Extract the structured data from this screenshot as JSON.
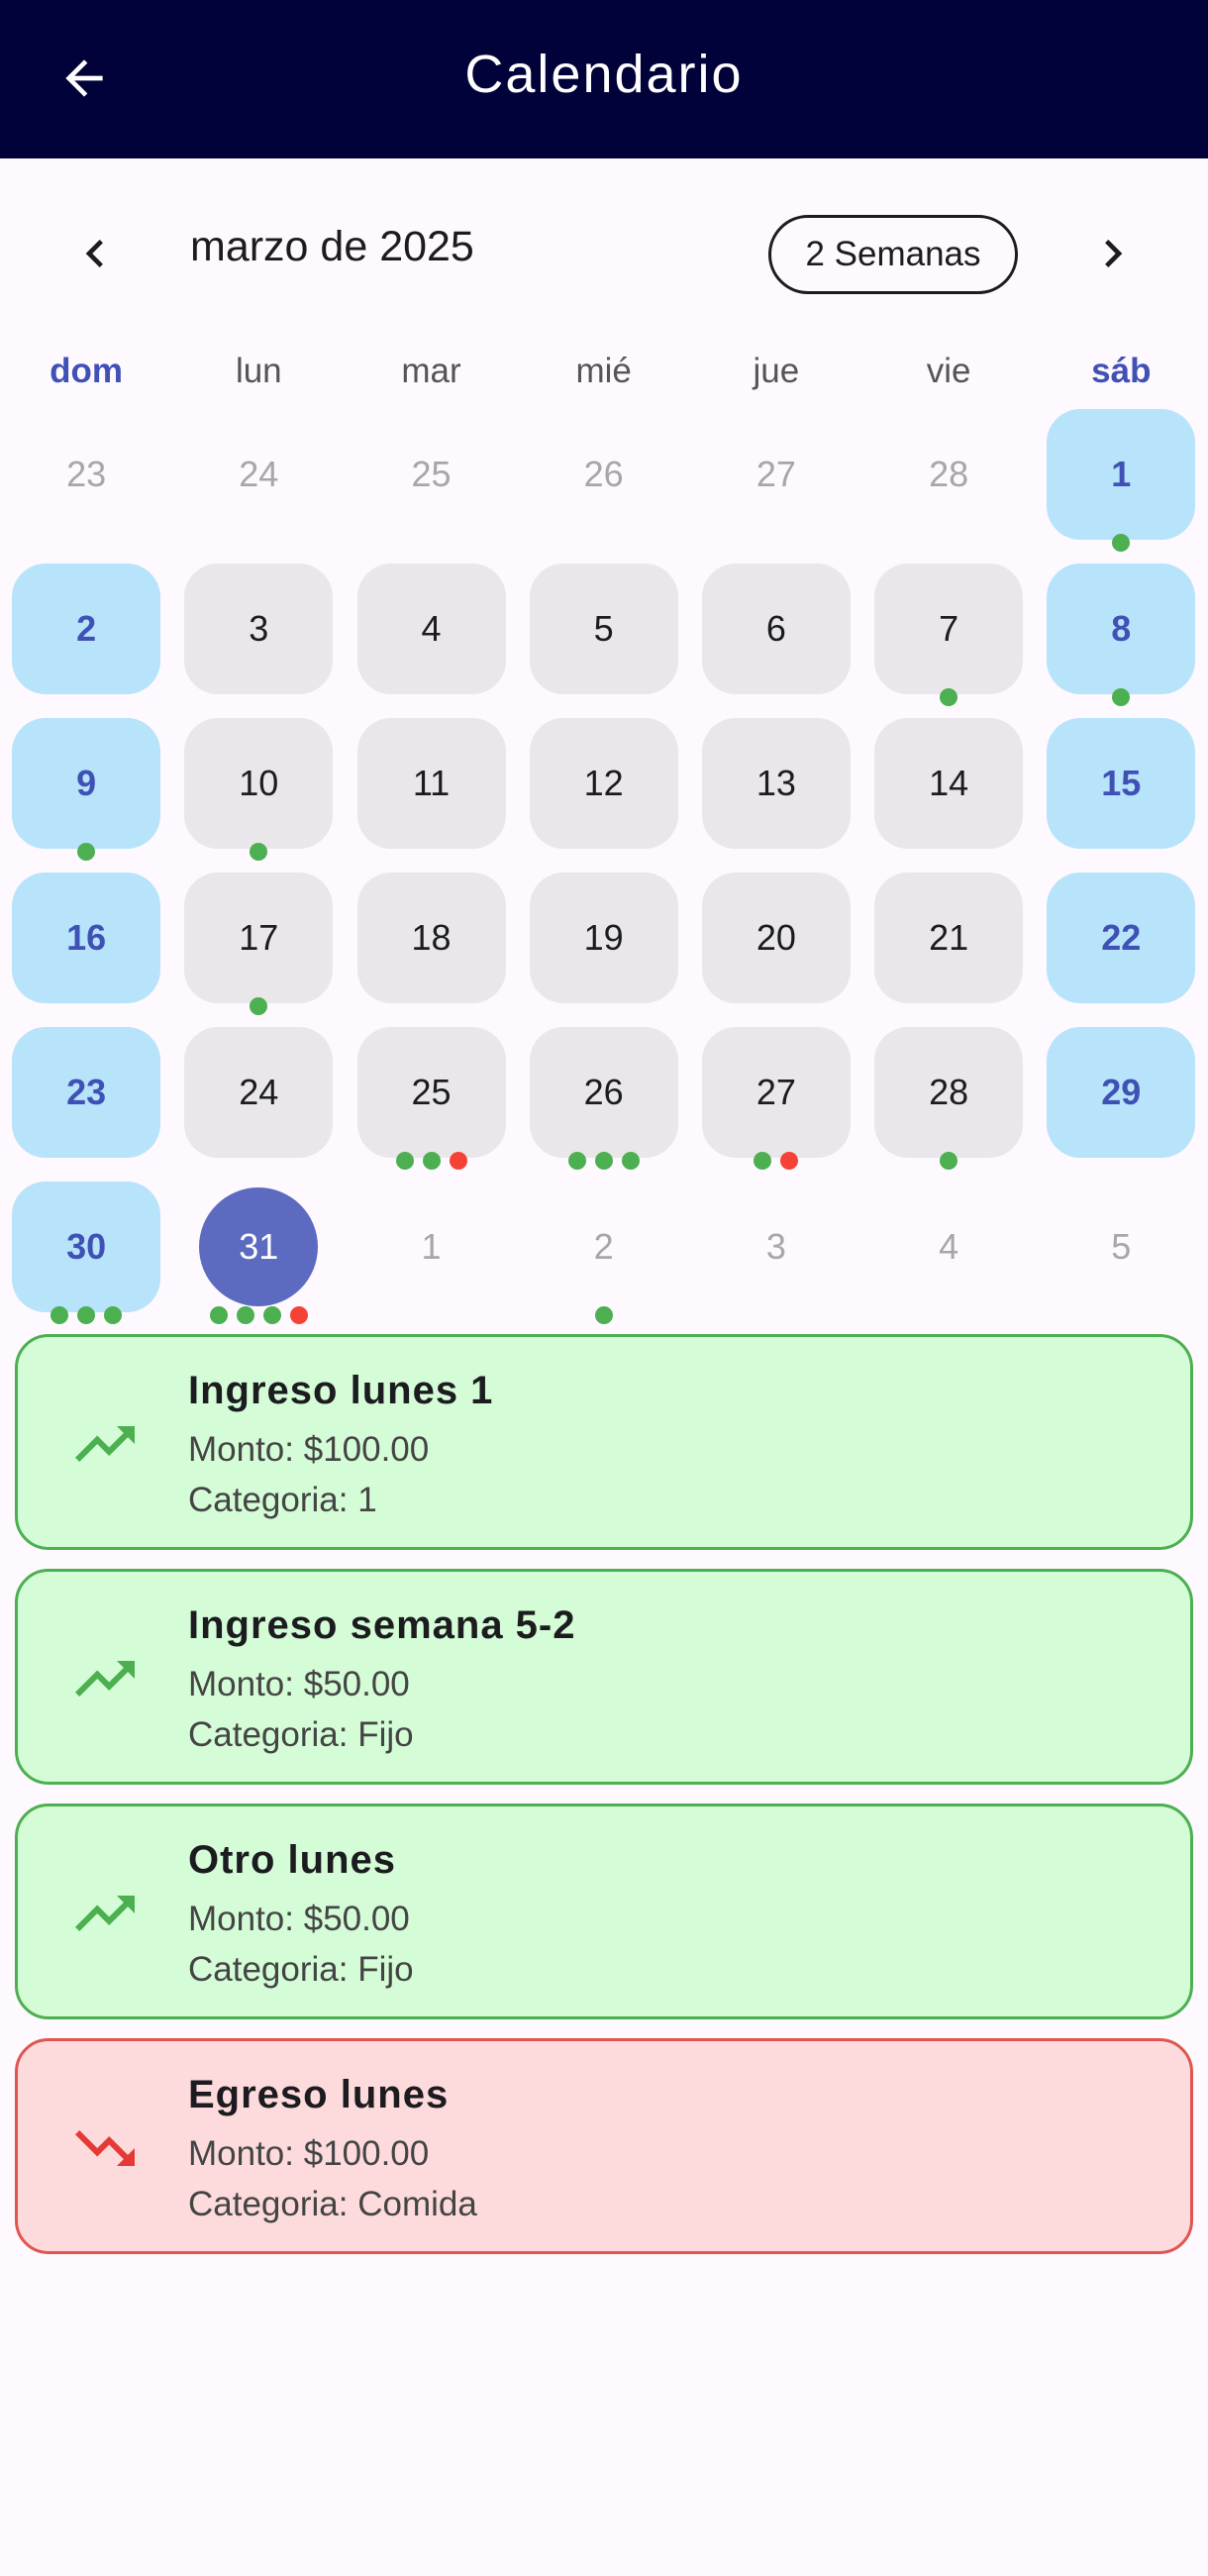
{
  "app_bar": {
    "title": "Calendario",
    "back_icon": "arrow-back-icon",
    "background": "#02023a"
  },
  "calendar": {
    "month_title": "marzo de 2025",
    "format_button": "2 Semanas",
    "prev_icon": "chevron-left-icon",
    "next_icon": "chevron-right-icon",
    "weekdays": [
      "dom",
      "lun",
      "mar",
      "mié",
      "jue",
      "vie",
      "sáb"
    ],
    "selected_day": "31",
    "colors": {
      "weekend_bg": "#b7e3fb",
      "weekday_bg": "#e9e7ea",
      "selected_bg": "#5c6bc0",
      "ingreso_marker": "#4caf50",
      "egreso_marker": "#f44336"
    },
    "weeks": [
      [
        {
          "day": "23",
          "type": "outside",
          "markers": []
        },
        {
          "day": "24",
          "type": "outside",
          "markers": []
        },
        {
          "day": "25",
          "type": "outside",
          "markers": []
        },
        {
          "day": "26",
          "type": "outside",
          "markers": []
        },
        {
          "day": "27",
          "type": "outside",
          "markers": []
        },
        {
          "day": "28",
          "type": "outside",
          "markers": []
        },
        {
          "day": "1",
          "type": "weekend",
          "markers": [
            "ingreso"
          ]
        }
      ],
      [
        {
          "day": "2",
          "type": "weekend",
          "markers": []
        },
        {
          "day": "3",
          "type": "weekday",
          "markers": []
        },
        {
          "day": "4",
          "type": "weekday",
          "markers": []
        },
        {
          "day": "5",
          "type": "weekday",
          "markers": []
        },
        {
          "day": "6",
          "type": "weekday",
          "markers": []
        },
        {
          "day": "7",
          "type": "weekday",
          "markers": [
            "ingreso"
          ]
        },
        {
          "day": "8",
          "type": "weekend",
          "markers": [
            "ingreso"
          ]
        }
      ],
      [
        {
          "day": "9",
          "type": "weekend",
          "markers": [
            "ingreso"
          ]
        },
        {
          "day": "10",
          "type": "weekday",
          "markers": [
            "ingreso"
          ]
        },
        {
          "day": "11",
          "type": "weekday",
          "markers": []
        },
        {
          "day": "12",
          "type": "weekday",
          "markers": []
        },
        {
          "day": "13",
          "type": "weekday",
          "markers": []
        },
        {
          "day": "14",
          "type": "weekday",
          "markers": []
        },
        {
          "day": "15",
          "type": "weekend",
          "markers": []
        }
      ],
      [
        {
          "day": "16",
          "type": "weekend",
          "markers": []
        },
        {
          "day": "17",
          "type": "weekday",
          "markers": [
            "ingreso"
          ]
        },
        {
          "day": "18",
          "type": "weekday",
          "markers": []
        },
        {
          "day": "19",
          "type": "weekday",
          "markers": []
        },
        {
          "day": "20",
          "type": "weekday",
          "markers": []
        },
        {
          "day": "21",
          "type": "weekday",
          "markers": []
        },
        {
          "day": "22",
          "type": "weekend",
          "markers": []
        }
      ],
      [
        {
          "day": "23",
          "type": "weekend",
          "markers": []
        },
        {
          "day": "24",
          "type": "weekday",
          "markers": []
        },
        {
          "day": "25",
          "type": "weekday",
          "markers": [
            "ingreso",
            "ingreso",
            "egreso"
          ]
        },
        {
          "day": "26",
          "type": "weekday",
          "markers": [
            "ingreso",
            "ingreso",
            "ingreso"
          ]
        },
        {
          "day": "27",
          "type": "weekday",
          "markers": [
            "ingreso",
            "egreso"
          ]
        },
        {
          "day": "28",
          "type": "weekday",
          "markers": [
            "ingreso"
          ]
        },
        {
          "day": "29",
          "type": "weekend",
          "markers": []
        }
      ],
      [
        {
          "day": "30",
          "type": "weekend",
          "markers": [
            "ingreso",
            "ingreso",
            "ingreso"
          ]
        },
        {
          "day": "31",
          "type": "selected",
          "markers": [
            "ingreso",
            "ingreso",
            "ingreso",
            "egreso"
          ]
        },
        {
          "day": "1",
          "type": "outside",
          "markers": []
        },
        {
          "day": "2",
          "type": "outside",
          "markers": [
            "ingreso"
          ]
        },
        {
          "day": "3",
          "type": "outside",
          "markers": []
        },
        {
          "day": "4",
          "type": "outside",
          "markers": []
        },
        {
          "day": "5",
          "type": "outside",
          "markers": []
        }
      ]
    ]
  },
  "events": [
    {
      "title": "Ingreso lunes 1",
      "amount": "Monto: $100.00",
      "category": "Categoria: 1",
      "kind": "ingreso",
      "icon": "trending-up-icon"
    },
    {
      "title": "Ingreso semana 5-2",
      "amount": "Monto: $50.00",
      "category": "Categoria: Fijo",
      "kind": "ingreso",
      "icon": "trending-up-icon"
    },
    {
      "title": "Otro lunes",
      "amount": "Monto: $50.00",
      "category": "Categoria: Fijo",
      "kind": "ingreso",
      "icon": "trending-up-icon"
    },
    {
      "title": "Egreso lunes",
      "amount": "Monto: $100.00",
      "category": "Categoria: Comida",
      "kind": "egreso",
      "icon": "trending-down-icon"
    }
  ]
}
